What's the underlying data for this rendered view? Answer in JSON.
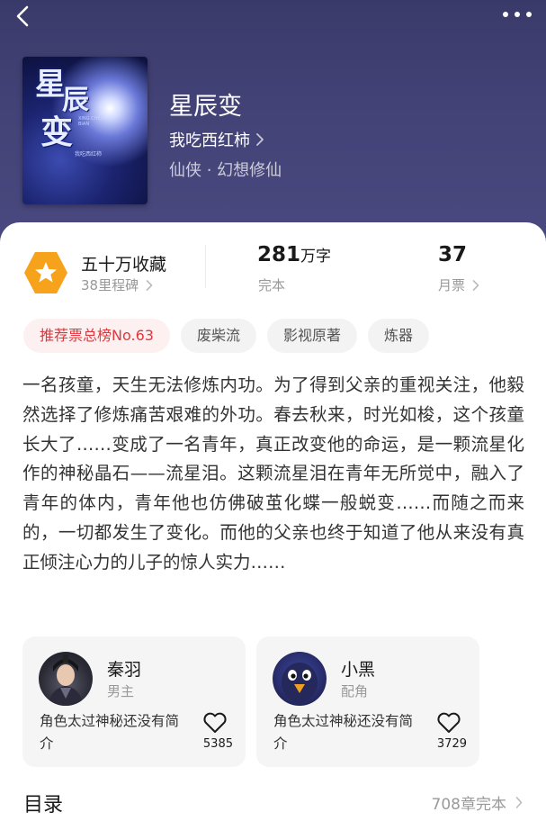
{
  "nav": {
    "back_icon": "chevron-left-icon",
    "more_icon": "more-horizontal-icon"
  },
  "book": {
    "cover_title_chars": [
      "星",
      "辰",
      "变"
    ],
    "cover_subtitle": "XING CHEN BIAN",
    "cover_author": "我吃西红柿",
    "title": "星辰变",
    "author": "我吃西红柿",
    "genre": "仙侠 · 幻想修仙"
  },
  "stats": {
    "favorites_title": "五十万收藏",
    "milestones": "38里程碑",
    "word_count": "281",
    "word_unit": "万字",
    "status": "完本",
    "monthly_tickets": "37",
    "monthly_tickets_label": "月票"
  },
  "tags": [
    {
      "label": "推荐票总榜No.63",
      "hot": true
    },
    {
      "label": "废柴流",
      "hot": false
    },
    {
      "label": "影视原著",
      "hot": false
    },
    {
      "label": "炼器",
      "hot": false
    }
  ],
  "synopsis": "一名孩童，天生无法修炼内功。为了得到父亲的重视关注，他毅然选择了修炼痛苦艰难的外功。春去秋来，时光如梭，这个孩童长大了……变成了一名青年，真正改变他的命运，是一颗流星化作的神秘晶石——流星泪。这颗流星泪在青年无所觉中，融入了青年的体内，青年他也仿佛破茧化蝶一般蜕变……而随之而来的，一切都发生了变化。而他的父亲也终于知道了他从来没有真正倾注心力的儿子的惊人实力……",
  "characters": [
    {
      "name": "秦羽",
      "role": "男主",
      "desc": "角色太过神秘还没有简介",
      "likes": "5385"
    },
    {
      "name": "小黑",
      "role": "配角",
      "desc": "角色太过神秘还没有简介",
      "likes": "3729"
    }
  ],
  "toc": {
    "title": "目录",
    "status": "708章完本"
  },
  "colors": {
    "header_bg": "#444378",
    "hot_tag_text": "#e0383e",
    "hot_tag_bg": "#fdf0f0",
    "badge": "#f7a21b"
  }
}
